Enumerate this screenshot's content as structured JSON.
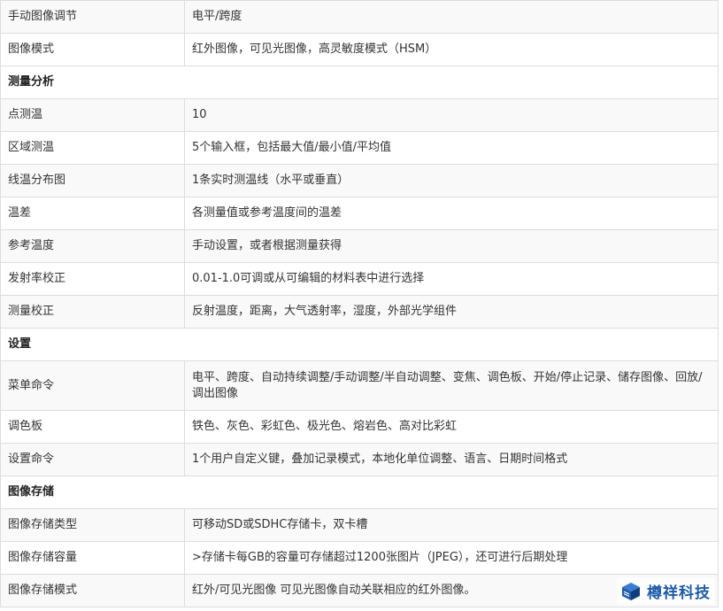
{
  "rows": [
    {
      "type": "data",
      "label": "手动图像调节",
      "value": "电平/跨度"
    },
    {
      "type": "data",
      "label": "图像模式",
      "value": "红外图像，可见光图像，高灵敏度模式（HSM）"
    },
    {
      "type": "section",
      "label": "测量分析"
    },
    {
      "type": "data",
      "label": "点测温",
      "value": "10"
    },
    {
      "type": "data",
      "label": "区域测温",
      "value": "5个输入框，包括最大值/最小值/平均值"
    },
    {
      "type": "data",
      "label": "线温分布图",
      "value": "1条实时测温线（水平或垂直）"
    },
    {
      "type": "data",
      "label": "温差",
      "value": "各测量值或参考温度间的温差"
    },
    {
      "type": "data",
      "label": "参考温度",
      "value": "手动设置，或者根据测量获得"
    },
    {
      "type": "data",
      "label": "发射率校正",
      "value": "0.01-1.0可调或从可编辑的材料表中进行选择"
    },
    {
      "type": "data",
      "label": "测量校正",
      "value": "反射温度，距离，大气透射率，湿度，外部光学组件"
    },
    {
      "type": "section",
      "label": "设置"
    },
    {
      "type": "data",
      "label": "菜单命令",
      "value": "电平、跨度、自动持续调整/手动调整/半自动调整、变焦、调色板、开始/停止记录、储存图像、回放/调出图像"
    },
    {
      "type": "data",
      "label": "调色板",
      "value": "铁色、灰色、彩虹色、极光色、熔岩色、高对比彩虹"
    },
    {
      "type": "data",
      "label": "设置命令",
      "value": "1个用户自定义键，叠加记录模式，本地化单位调整、语言、日期时间格式"
    },
    {
      "type": "section",
      "label": "图像存储"
    },
    {
      "type": "data",
      "label": "图像存储类型",
      "value": "可移动SD或SDHC存储卡，双卡槽"
    },
    {
      "type": "data",
      "label": "图像存储容量",
      "value": ">存储卡每GB的容量可存储超过1200张图片（JPEG），还可进行后期处理"
    },
    {
      "type": "data",
      "label": "图像存储模式",
      "value": "红外/可见光图像 可见光图像自动关联相应的红外图像。"
    }
  ],
  "watermark": {
    "text": "樽祥科技",
    "icon": "cube-logo-icon",
    "color": "#1e5ba6"
  }
}
